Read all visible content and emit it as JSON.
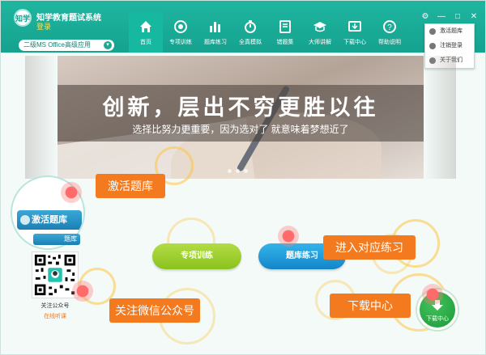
{
  "app": {
    "logo_text": "知学",
    "title": "知学教育题试系统",
    "login_label": "登录",
    "exam_selector": "二级MS Office高级应用"
  },
  "nav": {
    "items": [
      {
        "label": "首页",
        "icon": "home-icon",
        "active": true
      },
      {
        "label": "专项训练",
        "icon": "target-icon",
        "active": false
      },
      {
        "label": "题库练习",
        "icon": "bar-chart-icon",
        "active": false
      },
      {
        "label": "全真模拟",
        "icon": "stopwatch-icon",
        "active": false
      },
      {
        "label": "错题集",
        "icon": "book-icon",
        "active": false
      },
      {
        "label": "大师讲解",
        "icon": "graduation-cap-icon",
        "active": false
      },
      {
        "label": "下载中心",
        "icon": "download-icon",
        "active": false
      },
      {
        "label": "帮助说明",
        "icon": "help-icon",
        "active": false
      }
    ]
  },
  "window": {
    "settings_icon": "gear-icon",
    "minimize": "—",
    "maximize": "□",
    "close": "✕"
  },
  "settings_menu": {
    "items": [
      {
        "label": "激活题库",
        "icon": "lock-icon"
      },
      {
        "label": "注销登录",
        "icon": "user-icon"
      },
      {
        "label": "关于我们",
        "icon": "info-icon"
      }
    ]
  },
  "banner": {
    "title": "创新，层出不穷更胜以往",
    "subtitle": "选择比努力更重要，因为选对了 就意味着梦想近了"
  },
  "callouts": {
    "activate": "激活题库",
    "enter_practice": "进入对应练习",
    "follow_wechat": "关注微信公众号",
    "download_center": "下载中心"
  },
  "main": {
    "activate_button": "激活题库",
    "activate_button_small": "题库",
    "special_training_button": "专项训练",
    "question_bank_button": "题库练习",
    "download_button": "下载中心"
  },
  "qr": {
    "label": "关注公众号",
    "sub_label": "在线听课"
  },
  "colors": {
    "header": "#1fb6a0",
    "callout": "#f47a1f",
    "green_button": "#8bc21e",
    "blue_button": "#1385c9",
    "download_button": "#1e9a3a"
  }
}
